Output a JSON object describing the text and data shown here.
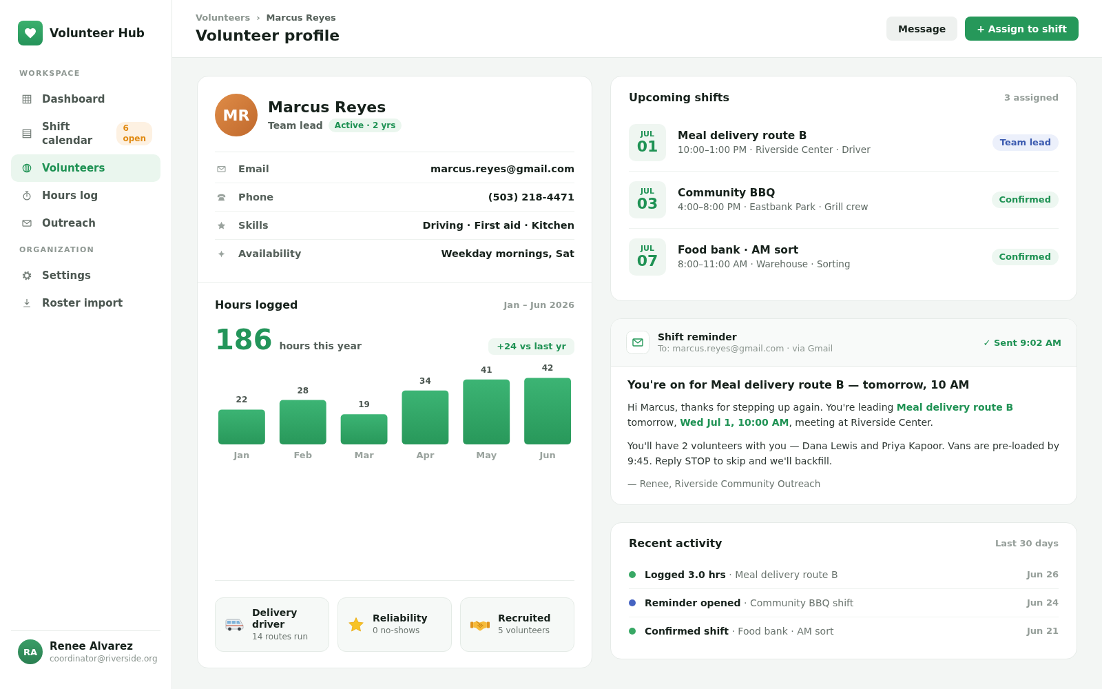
{
  "sidebar": {
    "app_name": "Volunteer Hub",
    "sections": [
      {
        "label": "WORKSPACE",
        "items": [
          {
            "label": "Dashboard",
            "selected": false
          },
          {
            "label": "Shift calendar",
            "selected": false,
            "badge": "6 open"
          },
          {
            "label": "Volunteers",
            "selected": true
          },
          {
            "label": "Hours log",
            "selected": false
          },
          {
            "label": "Outreach",
            "selected": false
          }
        ]
      },
      {
        "label": "ORGANIZATION",
        "items": [
          {
            "label": "Settings",
            "selected": false
          },
          {
            "label": "Roster import",
            "selected": false
          }
        ]
      }
    ],
    "user": {
      "initials": "RA",
      "name": "Renee Alvarez",
      "email": "coordinator@riverside.org"
    }
  },
  "header": {
    "breadcrumb": [
      "Volunteers",
      "Marcus Reyes"
    ],
    "separator": "›",
    "title": "Volunteer profile",
    "buttons": [
      {
        "label": "Message",
        "kind": "secondary"
      },
      {
        "label": "+ Assign to shift",
        "kind": "primary"
      }
    ]
  },
  "profile": {
    "initials": "MR",
    "name": "Marcus Reyes",
    "role": "Team lead",
    "status": "Active · 2 yrs",
    "details": [
      {
        "label": "Email",
        "value": "marcus.reyes@gmail.com"
      },
      {
        "label": "Phone",
        "value": "(503) 218-4471"
      },
      {
        "label": "Skills",
        "value": "Driving · First aid · Kitchen"
      },
      {
        "label": "Availability",
        "value": "Weekday mornings, Sat"
      }
    ]
  },
  "hours": {
    "title": "Hours logged",
    "range": "Jan – Jun 2026",
    "total": "186",
    "total_label": "hours this year",
    "delta": "+24 vs last yr",
    "chart_data": {
      "type": "bar",
      "categories": [
        "Jan",
        "Feb",
        "Mar",
        "Apr",
        "May",
        "Jun"
      ],
      "values": [
        22,
        28,
        19,
        34,
        41,
        42
      ],
      "data_labels": true
    }
  },
  "achievements": [
    {
      "title": "Delivery driver",
      "subtitle": "14 routes run"
    },
    {
      "title": "Reliability",
      "subtitle": "0 no-shows"
    },
    {
      "title": "Recruited",
      "subtitle": "5 volunteers"
    }
  ],
  "upcoming_shifts": {
    "title": "Upcoming shifts",
    "count": "3 assigned",
    "shifts": [
      {
        "month": "JUL",
        "day": "01",
        "title": "Meal delivery route B",
        "details": "10:00–1:00 PM · Riverside Center · Driver",
        "tag": {
          "label": "Team lead",
          "kind": "role"
        }
      },
      {
        "month": "JUL",
        "day": "03",
        "title": "Community BBQ",
        "details": "4:00–8:00 PM · Eastbank Park · Grill crew",
        "tag": {
          "label": "Confirmed",
          "kind": "confirmed"
        }
      },
      {
        "month": "JUL",
        "day": "07",
        "title": "Food bank · AM sort",
        "details": "8:00–11:00 AM · Warehouse · Sorting",
        "tag": {
          "label": "Confirmed",
          "kind": "confirmed"
        }
      }
    ]
  },
  "reminder": {
    "title": "Shift reminder",
    "recipient": "To: marcus.reyes@gmail.com · via Gmail",
    "status": "✓ Sent 9:02 AM",
    "subject": "You're on for Meal delivery route B — tomorrow, 10 AM",
    "paragraphs": [
      "Hi Marcus, thanks for stepping up again. You're leading **Meal delivery route B** tomorrow, **Wed Jul 1, 10:00 AM**, meeting at Riverside Center.",
      "You'll have 2 volunteers with you — Dana Lewis and Priya Kapoor. Vans are pre-loaded by 9:45. Reply STOP to skip and we'll backfill."
    ],
    "signature": "— Renee, Riverside Community Outreach"
  },
  "activity": {
    "title": "Recent activity",
    "range": "Last 30 days",
    "items": [
      {
        "text": "**Logged 3.0 hrs** · Meal delivery route B",
        "date": "Jun 26",
        "color": "#38a865"
      },
      {
        "text": "**Reminder opened** · Community BBQ shift",
        "date": "Jun 24",
        "color": "#4563c2"
      },
      {
        "text": "**Confirmed shift** · Food bank · AM sort",
        "date": "Jun 21",
        "color": "#38a865"
      }
    ]
  }
}
